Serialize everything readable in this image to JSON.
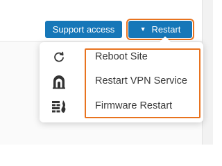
{
  "toolbar": {
    "support_label": "Support access",
    "restart_label": "Restart",
    "restart_caret": "▼"
  },
  "restart_menu": {
    "items": [
      {
        "label": "Reboot Site",
        "icon": "refresh-icon"
      },
      {
        "label": "Restart VPN Service",
        "icon": "vpn-tunnel-icon"
      },
      {
        "label": "Firmware Restart",
        "icon": "firmware-icon"
      }
    ]
  },
  "colors": {
    "button_blue": "#1677b8",
    "highlight_orange": "#e8731f",
    "icon_dark": "#333333"
  }
}
